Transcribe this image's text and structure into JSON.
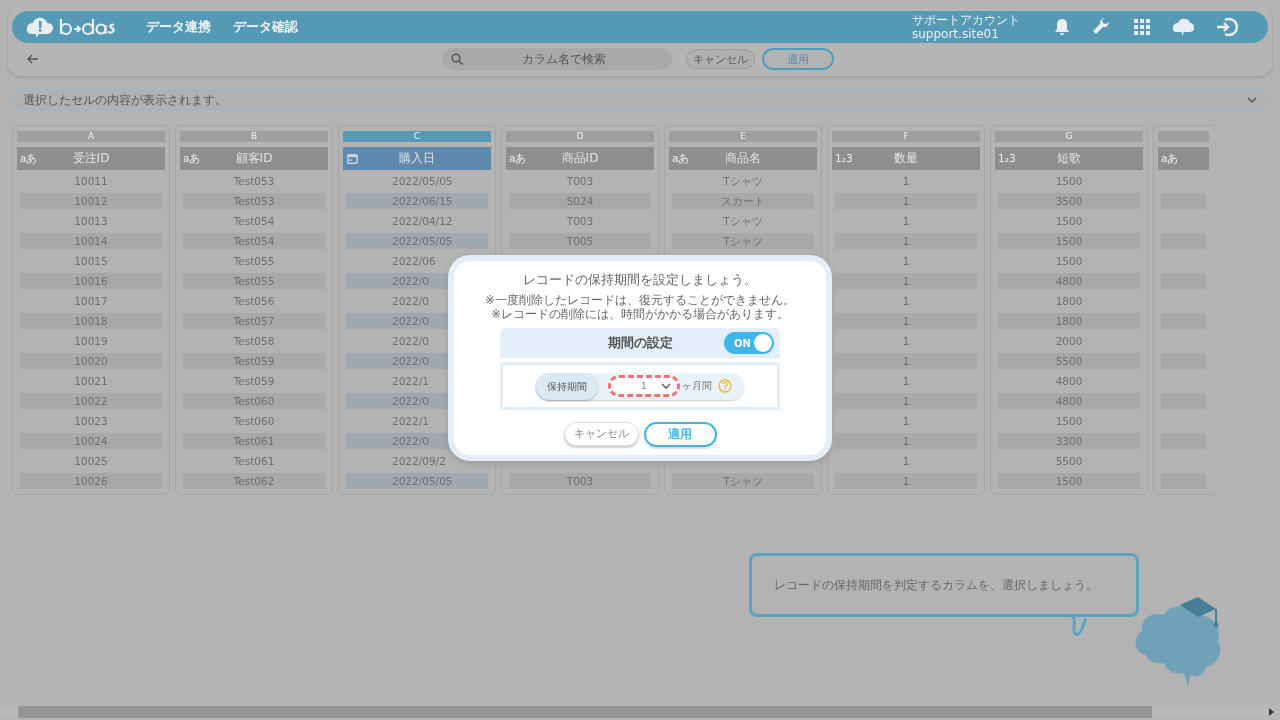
{
  "header": {
    "nav": [
      "データ連携",
      "データ確認"
    ],
    "account": {
      "name": "サポートアカウント",
      "id": "support.site01"
    }
  },
  "toolbar": {
    "search_placeholder": "カラム名で検索",
    "cancel": "キャンセル",
    "apply": "適用"
  },
  "cell_display": {
    "placeholder": "選択したセルの内容が表示されます。"
  },
  "table": {
    "columns": [
      {
        "letter": "A",
        "name": "受注ID",
        "kind": "text",
        "type_mark": "aあ",
        "selected": false,
        "cells": [
          "10011",
          "10012",
          "10013",
          "10014",
          "10015",
          "10016",
          "10017",
          "10018",
          "10019",
          "10020",
          "10021",
          "10022",
          "10023",
          "10024",
          "10025",
          "10026"
        ]
      },
      {
        "letter": "B",
        "name": "顧客ID",
        "kind": "text",
        "type_mark": "aあ",
        "selected": false,
        "cells": [
          "Test053",
          "Test053",
          "Test054",
          "Test054",
          "Test055",
          "Test055",
          "Test056",
          "Test057",
          "Test058",
          "Test059",
          "Test059",
          "Test060",
          "Test060",
          "Test061",
          "Test061",
          "Test062"
        ]
      },
      {
        "letter": "C",
        "name": "購入日",
        "kind": "date",
        "selected": true,
        "cells": [
          "2022/05/05",
          "2022/06/15",
          "2022/04/12",
          "2022/05/05",
          "2022/06",
          "2022/0",
          "2022/0",
          "2022/0",
          "2022/0",
          "2022/0",
          "2022/1",
          "2022/0",
          "2022/1",
          "2022/0",
          "2022/09/2",
          "2022/05/05"
        ]
      },
      {
        "letter": "D",
        "name": "商品ID",
        "kind": "text",
        "type_mark": "aあ",
        "selected": false,
        "cells": [
          "T003",
          "S024",
          "T003",
          "T005",
          null,
          null,
          null,
          null,
          null,
          null,
          null,
          null,
          null,
          null,
          null,
          "T003"
        ]
      },
      {
        "letter": "E",
        "name": "商品名",
        "kind": "text",
        "type_mark": "aあ",
        "selected": false,
        "cells": [
          "Tシャツ",
          "スカート",
          "Tシャツ",
          "Tシャツ",
          null,
          null,
          null,
          null,
          null,
          null,
          null,
          null,
          null,
          null,
          null,
          "Tシャツ"
        ]
      },
      {
        "letter": "F",
        "name": "数量",
        "kind": "number",
        "type_mark": "1₂3",
        "selected": false,
        "cells": [
          "1",
          "1",
          "1",
          "1",
          "1",
          "1",
          "1",
          "1",
          "1",
          "1",
          "1",
          "1",
          "1",
          "1",
          "1",
          "1"
        ]
      },
      {
        "letter": "G",
        "name": "短歌",
        "kind": "number",
        "type_mark": "1₂3",
        "selected": false,
        "cells": [
          "1500",
          "3500",
          "1500",
          "1500",
          "1500",
          "4800",
          "1800",
          "1800",
          "2000",
          "5500",
          "4800",
          "4800",
          "1500",
          "3300",
          "5500",
          "1500"
        ]
      },
      {
        "kind": "text",
        "type_mark": "aあ",
        "selected": false,
        "cells": [
          null,
          null,
          null,
          null,
          null,
          null,
          null,
          null,
          null,
          null,
          null,
          null,
          null,
          null,
          null,
          null
        ]
      }
    ]
  },
  "dialog": {
    "title": "レコードの保持期間を設定しましょう。",
    "notes": [
      "※一度削除したレコードは、復元することができません。",
      "※レコードの削除には、時間がかかる場合があります。"
    ],
    "setting": {
      "label": "期間の設定",
      "toggle_text": "ON",
      "on": true
    },
    "period": {
      "label": "保持期間",
      "value": "1",
      "unit": "ヶ月間",
      "highlighted": true
    },
    "cancel": "キャンセル",
    "apply": "適用"
  },
  "guide": {
    "message": "レコードの保持期間を判定するカラムを、選択しましょう。"
  }
}
